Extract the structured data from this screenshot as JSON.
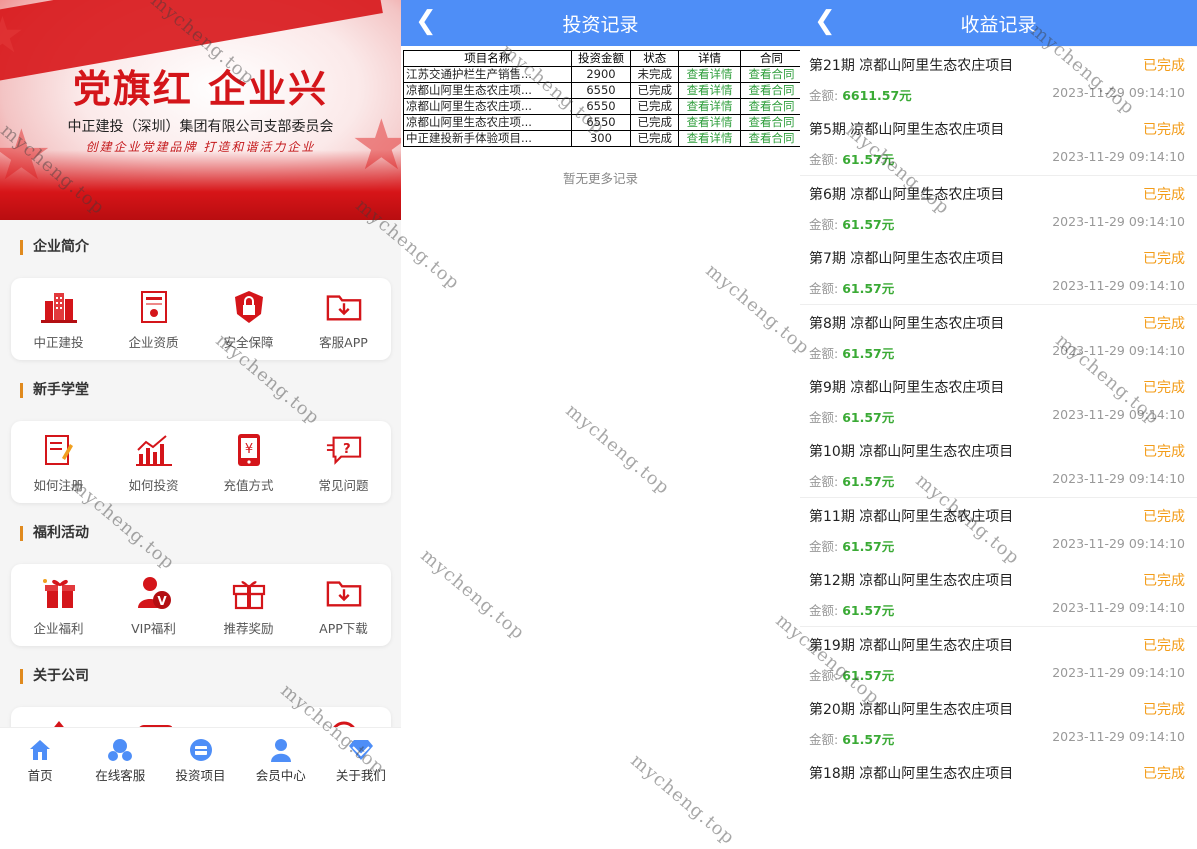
{
  "left_panel": {
    "banner": {
      "title": "党旗红 企业兴",
      "subtitle": "中正建投（深圳）集团有限公司支部委员会",
      "slogan": "创建企业党建品牌 打造和谐活力企业"
    },
    "sections": [
      {
        "title": "企业简介",
        "items": [
          {
            "label": "中正建投",
            "icon": "building-icon"
          },
          {
            "label": "企业资质",
            "icon": "certificate-icon"
          },
          {
            "label": "安全保障",
            "icon": "shield-lock-icon"
          },
          {
            "label": "客服APP",
            "icon": "download-box-icon"
          }
        ]
      },
      {
        "title": "新手学堂",
        "items": [
          {
            "label": "如何注册",
            "icon": "register-icon"
          },
          {
            "label": "如何投资",
            "icon": "chart-icon"
          },
          {
            "label": "充值方式",
            "icon": "phone-yen-icon"
          },
          {
            "label": "常见问题",
            "icon": "question-bubble-icon"
          }
        ]
      },
      {
        "title": "福利活动",
        "items": [
          {
            "label": "企业福利",
            "icon": "gift-icon"
          },
          {
            "label": "VIP福利",
            "icon": "vip-user-icon"
          },
          {
            "label": "推荐奖励",
            "icon": "gift-box-icon"
          },
          {
            "label": "APP下载",
            "icon": "download-box-icon"
          }
        ]
      },
      {
        "title": "关于公司",
        "items": []
      }
    ],
    "tabbar": [
      {
        "label": "首页",
        "icon": "home-icon"
      },
      {
        "label": "在线客服",
        "icon": "support-icon"
      },
      {
        "label": "投资项目",
        "icon": "wallet-icon"
      },
      {
        "label": "会员中心",
        "icon": "user-icon"
      },
      {
        "label": "关于我们",
        "icon": "diamond-icon"
      }
    ]
  },
  "invest_panel": {
    "title": "投资记录",
    "columns": [
      "项目名称",
      "投资金额",
      "状态",
      "详情",
      "合同"
    ],
    "rows": [
      {
        "name": "江苏交通护栏生产销售...",
        "amount": "2900",
        "status": "未完成",
        "detail": "查看详情",
        "contract": "查看合同"
      },
      {
        "name": "凉都山阿里生态农庄项...",
        "amount": "6550",
        "status": "已完成",
        "detail": "查看详情",
        "contract": "查看合同"
      },
      {
        "name": "凉都山阿里生态农庄项...",
        "amount": "6550",
        "status": "已完成",
        "detail": "查看详情",
        "contract": "查看合同"
      },
      {
        "name": "凉都山阿里生态农庄项...",
        "amount": "6550",
        "status": "已完成",
        "detail": "查看详情",
        "contract": "查看合同"
      },
      {
        "name": "中正建投新手体验项目...",
        "amount": "300",
        "status": "已完成",
        "detail": "查看详情",
        "contract": "查看合同"
      }
    ],
    "no_more": "暂无更多记录"
  },
  "income_panel": {
    "title": "收益记录",
    "amount_label": "金额:",
    "records": [
      {
        "title": "第21期 凉都山阿里生态农庄项目",
        "status": "已完成",
        "amount": "6611.57元",
        "date": "2023-11-29 09:14:10"
      },
      {
        "title": "第5期 凉都山阿里生态农庄项目",
        "status": "已完成",
        "amount": "61.57元",
        "date": "2023-11-29 09:14:10"
      },
      {
        "title": "第6期 凉都山阿里生态农庄项目",
        "status": "已完成",
        "amount": "61.57元",
        "date": "2023-11-29 09:14:10"
      },
      {
        "title": "第7期 凉都山阿里生态农庄项目",
        "status": "已完成",
        "amount": "61.57元",
        "date": "2023-11-29 09:14:10"
      },
      {
        "title": "第8期 凉都山阿里生态农庄项目",
        "status": "已完成",
        "amount": "61.57元",
        "date": "2023-11-29 09:14:10"
      },
      {
        "title": "第9期 凉都山阿里生态农庄项目",
        "status": "已完成",
        "amount": "61.57元",
        "date": "2023-11-29 09:14:10"
      },
      {
        "title": "第10期 凉都山阿里生态农庄项目",
        "status": "已完成",
        "amount": "61.57元",
        "date": "2023-11-29 09:14:10"
      },
      {
        "title": "第11期 凉都山阿里生态农庄项目",
        "status": "已完成",
        "amount": "61.57元",
        "date": "2023-11-29 09:14:10"
      },
      {
        "title": "第12期 凉都山阿里生态农庄项目",
        "status": "已完成",
        "amount": "61.57元",
        "date": "2023-11-29 09:14:10"
      },
      {
        "title": "第19期 凉都山阿里生态农庄项目",
        "status": "已完成",
        "amount": "61.57元",
        "date": "2023-11-29 09:14:10"
      },
      {
        "title": "第20期 凉都山阿里生态农庄项目",
        "status": "已完成",
        "amount": "61.57元",
        "date": "2023-11-29 09:14:10"
      },
      {
        "title": "第18期 凉都山阿里生态农庄项目",
        "status": "已完成",
        "amount": "",
        "date": ""
      }
    ]
  },
  "watermark": "mycheng.top",
  "colors": {
    "header_blue": "#4e8ef7",
    "brand_red": "#d4151a",
    "link_green": "#2e9e3b",
    "done_orange": "#f39c19",
    "amount_green": "#3aaa35",
    "section_bar": "#e08a1e"
  }
}
